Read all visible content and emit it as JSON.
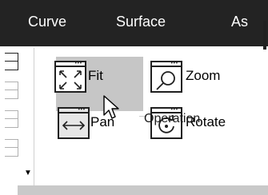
{
  "tabs": [
    {
      "label": "Curve"
    },
    {
      "label": "Surface"
    },
    {
      "label": "As"
    }
  ],
  "buttons": {
    "fit": {
      "label": "Fit",
      "icon": "fit-icon"
    },
    "zoom": {
      "label": "Zoom",
      "icon": "zoom-icon"
    },
    "pan": {
      "label": "Pan",
      "icon": "pan-icon",
      "state": "hovered"
    },
    "rotate": {
      "label": "Rotate",
      "icon": "rotate-icon"
    }
  },
  "group": {
    "label": "Operation"
  },
  "colors": {
    "tabbar_bg": "#232323",
    "tab_text": "#ffffff",
    "hover_bg": "#c6c6c6",
    "icon_stroke": "#202020"
  }
}
